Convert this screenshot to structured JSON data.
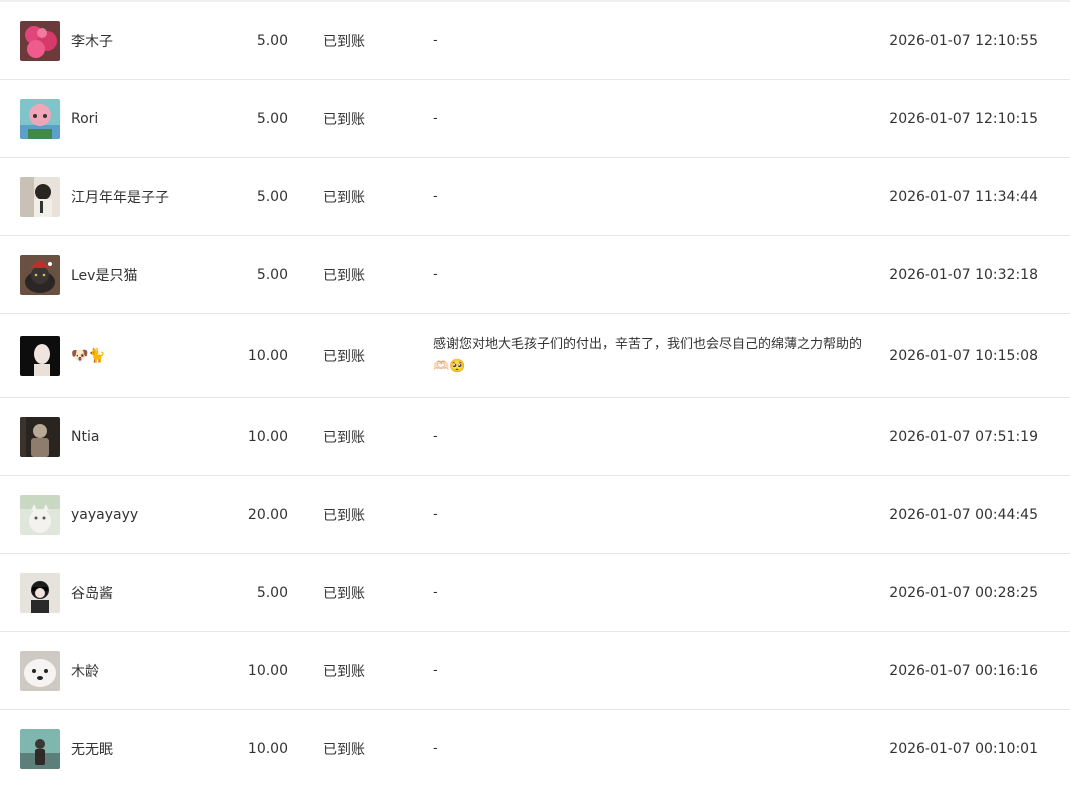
{
  "rows": [
    {
      "name": "李木子",
      "amount": "5.00",
      "status": "已到账",
      "message": "-",
      "time": "2026-01-07 12:10:55",
      "avatar": "pink-flowers"
    },
    {
      "name": "Rori",
      "amount": "5.00",
      "status": "已到账",
      "message": "-",
      "time": "2026-01-07 12:10:15",
      "avatar": "anime-character"
    },
    {
      "name": "江月年年是子子",
      "amount": "5.00",
      "status": "已到账",
      "message": "-",
      "time": "2026-01-07 11:34:44",
      "avatar": "person-portrait"
    },
    {
      "name": "Lev是只猫",
      "amount": "5.00",
      "status": "已到账",
      "message": "-",
      "time": "2026-01-07 10:32:18",
      "avatar": "black-cat"
    },
    {
      "name": "🐶🐈",
      "amount": "10.00",
      "status": "已到账",
      "message": "感谢您对地大毛孩子们的付出，辛苦了，我们也会尽自己的绵薄之力帮助的🫶🏻🥺",
      "time": "2026-01-07 10:15:08",
      "avatar": "woman-portrait"
    },
    {
      "name": "Ntia",
      "amount": "10.00",
      "status": "已到账",
      "message": "-",
      "time": "2026-01-07 07:51:19",
      "avatar": "dark-person"
    },
    {
      "name": "yayayayy",
      "amount": "20.00",
      "status": "已到账",
      "message": "-",
      "time": "2026-01-07 00:44:45",
      "avatar": "white-cat"
    },
    {
      "name": "谷岛酱",
      "amount": "5.00",
      "status": "已到账",
      "message": "-",
      "time": "2026-01-07 00:28:25",
      "avatar": "sunglasses-person"
    },
    {
      "name": "木龄",
      "amount": "10.00",
      "status": "已到账",
      "message": "-",
      "time": "2026-01-07 00:16:16",
      "avatar": "white-dog"
    },
    {
      "name": "无无眠",
      "amount": "10.00",
      "status": "已到账",
      "message": "-",
      "time": "2026-01-07 00:10:01",
      "avatar": "teal-scene"
    }
  ]
}
